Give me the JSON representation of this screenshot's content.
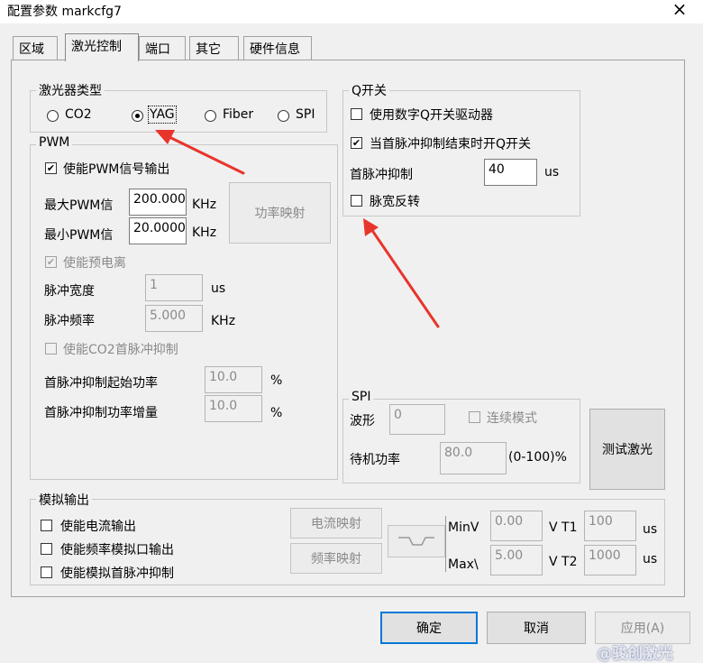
{
  "window": {
    "title": "配置参数 markcfg7",
    "close_glyph": "×"
  },
  "tabs": [
    "区域",
    "激光控制",
    "端口",
    "其它",
    "硬件信息"
  ],
  "laser_type": {
    "legend": "激光器类型",
    "options": [
      "CO2",
      "YAG",
      "Fiber",
      "SPI"
    ],
    "selected": "YAG"
  },
  "pwm": {
    "legend": "PWM",
    "enable_label": "使能PWM信号输出",
    "enable_checked": true,
    "max_label": "最大PWM信",
    "max_value": "200.000",
    "max_unit": "KHz",
    "min_label": "最小PWM信",
    "min_value": "20.0000",
    "min_unit": "KHz",
    "power_map_button": "功率映射",
    "prepulse_label": "使能预电离",
    "prepulse_checked": true,
    "pulse_width_label": "脉冲宽度",
    "pulse_width_value": "1",
    "pulse_width_unit": "us",
    "pulse_freq_label": "脉冲频率",
    "pulse_freq_value": "5.000",
    "pulse_freq_unit": "KHz",
    "co2_fps_label": "使能CO2首脉冲抑制",
    "co2_fps_checked": false,
    "fps_start_label": "首脉冲抑制起始功率",
    "fps_start_value": "10.0",
    "fps_start_unit": "%",
    "fps_inc_label": "首脉冲抑制功率增量",
    "fps_inc_value": "10.0",
    "fps_inc_unit": "%"
  },
  "qswitch": {
    "legend": "Q开关",
    "digital_driver_label": "使用数字Q开关驱动器",
    "digital_driver_checked": false,
    "open_after_fps_label": "当首脉冲抑制结束时开Q开关",
    "open_after_fps_checked": true,
    "fps_label": "首脉冲抑制",
    "fps_value": "40",
    "fps_unit": "us",
    "invert_label": "脉宽反转",
    "invert_checked": false
  },
  "spi": {
    "legend": "SPI",
    "waveform_label": "波形",
    "waveform_value": "0",
    "continuous_label": "连续模式",
    "continuous_checked": false,
    "standby_label": "待机功率",
    "standby_value": "80.0",
    "standby_range": "(0-100)%",
    "test_button": "测试激光"
  },
  "analog": {
    "legend": "模拟输出",
    "current_output_label": "使能电流输出",
    "freq_analog_label": "使能频率模拟口输出",
    "analog_fps_label": "使能模拟首脉冲抑制",
    "current_map_button": "电流映射",
    "freq_map_button": "频率映射",
    "minv_label": "MinV",
    "minv_value": "0.00",
    "maxv_label": "Max\\",
    "maxv_value": "5.00",
    "t1_label": "V T1",
    "t1_value": "100",
    "t1_unit": "us",
    "t2_label": "V T2",
    "t2_value": "1000",
    "t2_unit": "us"
  },
  "footer": {
    "ok": "确定",
    "cancel": "取消",
    "apply": "应用(A)"
  },
  "watermark": "@骏创激光",
  "colors": {
    "arrow": "#e8352b",
    "focus_border": "#0078d7"
  }
}
